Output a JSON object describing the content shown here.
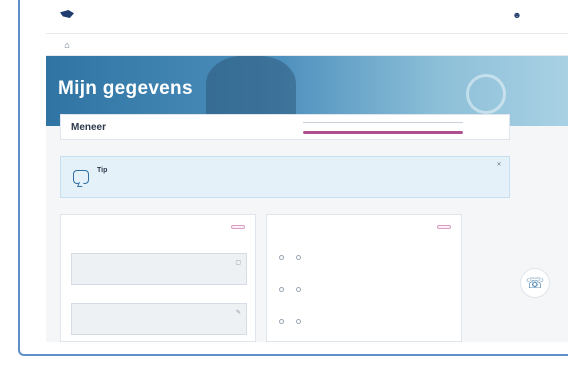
{
  "header": {
    "logo_text": "",
    "login_link": "",
    "user_icon": "user-icon"
  },
  "nav": {
    "home_icon": "home-icon",
    "items": [
      {
        "label": ""
      },
      {
        "label": ""
      },
      {
        "label": ""
      },
      {
        "label": ""
      },
      {
        "label": ""
      }
    ],
    "active_index": 3
  },
  "hero": {
    "title": "Mijn gegevens"
  },
  "name_card": {
    "title": "Meneer",
    "stat_label_1": "",
    "stat_label_2": "",
    "stat_bar_label": "",
    "stat_bar_right": "",
    "progress_fraction": 1.0,
    "progress_color": "#b04f8f"
  },
  "tip": {
    "title": "Tip",
    "text": "",
    "close_icon": "close-icon"
  },
  "left_panel": {
    "title": "",
    "badge": "",
    "fields": [
      {
        "label": "",
        "icon": "calendar-icon"
      },
      {
        "label": "",
        "icon": "edit-icon"
      }
    ]
  },
  "right_panel": {
    "title": "",
    "badge": "",
    "questions": [
      {
        "label": "",
        "options": [
          "",
          ""
        ]
      },
      {
        "label": "",
        "options": [
          "",
          ""
        ]
      },
      {
        "label": "",
        "options": [
          "",
          ""
        ]
      }
    ]
  },
  "help": {
    "icon": "support-icon",
    "label": ""
  },
  "colors": {
    "brand": "#1f3d6e",
    "accent": "#b04f8f",
    "tip_bg": "#e5f1f9",
    "frame_border": "#5e8fc6"
  }
}
